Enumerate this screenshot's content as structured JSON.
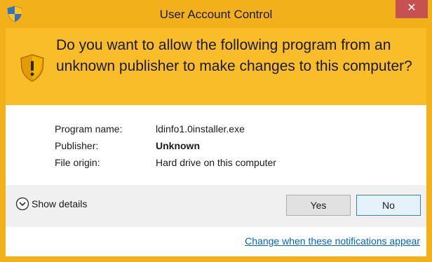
{
  "window": {
    "title": "User Account Control",
    "close_label": "✕"
  },
  "banner": {
    "question": "Do you want to allow the following program from an unknown publisher to make changes to this computer?"
  },
  "info": {
    "rows": [
      {
        "label": "Program name:",
        "value": "ldinfo1.0installer.exe"
      },
      {
        "label": "Publisher:",
        "value": "Unknown"
      },
      {
        "label": "File origin:",
        "value": "Hard drive on this computer"
      }
    ]
  },
  "footer": {
    "show_details": "Show details",
    "yes_label": "Yes",
    "no_label": "No",
    "change_link": "Change when these notifications appear"
  },
  "colors": {
    "title_bar": "#f2b11a",
    "banner": "#f9bd29",
    "close_button": "#c75050",
    "link": "#0066cc"
  },
  "icons": [
    "uac-shield-icon",
    "warning-shield-icon",
    "chevron-down-icon",
    "close-icon"
  ]
}
